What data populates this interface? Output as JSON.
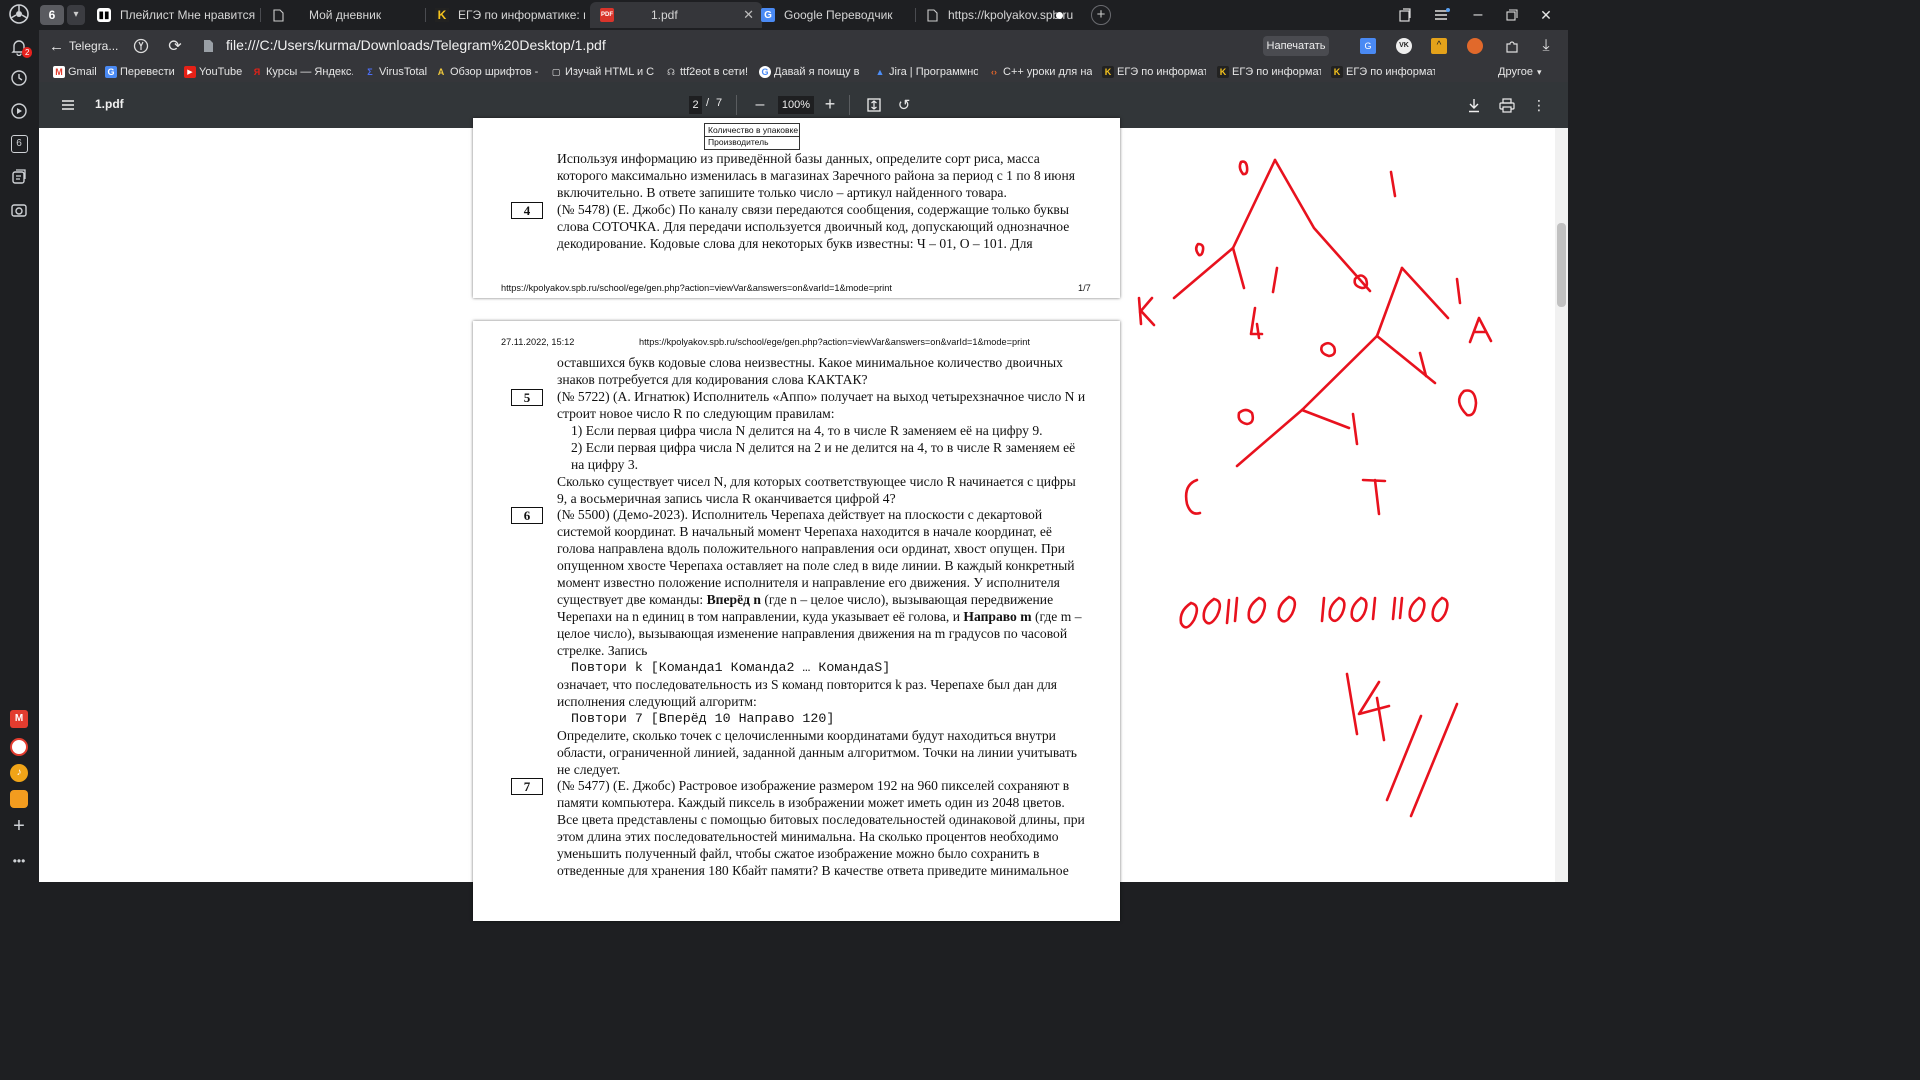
{
  "browser": {
    "tab_count": "6",
    "tabs": [
      {
        "title": "Плейлист Мне нравится -"
      },
      {
        "title": "Мой дневник"
      },
      {
        "title": "ЕГЭ по информатике: гене"
      },
      {
        "title": "1.pdf"
      },
      {
        "title": "Google Переводчик"
      },
      {
        "title": "https://kpolyakov.spb.ru"
      }
    ],
    "address": {
      "site_button": "Telegra...",
      "url": "file:///C:/Users/kurma/Downloads/Telegram%20Desktop/1.pdf",
      "print_label": "Напечатать"
    },
    "bookmarks": [
      "Gmail",
      "Перевести",
      "YouTube",
      "Курсы — Яндекс.",
      "VirusTotal",
      "Обзор шрифтов -",
      "Изучай HTML и С",
      "ttf2eot в сети!",
      "Давай я поищу в г",
      "Jira | Программно",
      "C++ уроки для на",
      "ЕГЭ по информат",
      "ЕГЭ по информат",
      "ЕГЭ по информат"
    ],
    "bookmarks_other": "Другое",
    "sidebar_badge": "2",
    "sidebar_tab_count": "6"
  },
  "pdf_toolbar": {
    "file_name": "1.pdf",
    "current_page": "2",
    "page_sep": "/",
    "total_pages": "7",
    "zoom": "100%"
  },
  "page1": {
    "table_row1": "Количество в упаковке",
    "table_row2": "Производитель",
    "lines": [
      "Используя информацию из приведённой базы данных, определите сорт риса, масса",
      "которого максимально изменилась в магазинах Заречного района за период с 1 по 8 июня",
      "включительно. В ответе запишите только число – артикул найденного товара.",
      "(№ 5478) (Е. Джобс) По каналу связи передаются сообщения, содержащие только буквы",
      "слова СОТОЧКА. Для передачи используется двоичный код, допускающий однозначное",
      "декодирование. Кодовые слова для некоторых букв известны: Ч – 01, О – 101. Для"
    ],
    "task_number": "4",
    "footer_url": "https://kpolyakov.spb.ru/school/ege/gen.php?action=viewVar&answers=on&varId=1&mode=print",
    "footer_page": "1/7"
  },
  "page2": {
    "header_date": "27.11.2022, 15:12",
    "header_url": "https://kpolyakov.spb.ru/school/ege/gen.php?action=viewVar&answers=on&varId=1&mode=print",
    "task_numbers": [
      "5",
      "6",
      "7"
    ],
    "lines": {
      "l01": "оставшихся букв кодовые слова неизвестны. Какое минимальное количество двоичных",
      "l02": "знаков потребуется для кодирования слова КАКТАК?",
      "l03": "(№ 5722) (А. Игнатюк) Исполнитель «Аппо» получает на выход четырехзначное число N и",
      "l04": "строит новое число R по следующим правилам:",
      "l05": "1) Если первая цифра числа N делится на 4, то в числе R заменяем её на цифру 9.",
      "l06": "2) Если первая цифра числа N делится на 2 и не делится на 4, то в числе R заменяем её",
      "l07": "на цифру 3.",
      "l08": "Сколько существует чисел N, для которых соответствующее число R начинается с цифры",
      "l09": "9, а восьмеричная запись числа R оканчивается цифрой 4?",
      "l10": "(№ 5500) (Демо-2023). Исполнитель Черепаха действует на плоскости с декартовой",
      "l11": "системой координат. В начальный момент Черепаха находится в начале координат, её",
      "l12": "голова направлена вдоль положительного направления оси ординат, хвост опущен. При",
      "l13": "опущенном хвосте Черепаха оставляет на поле след в виде линии. В каждый конкретный",
      "l14": "момент известно положение исполнителя и направление его движения. У исполнителя",
      "l15a": "существует две команды: ",
      "l15b": "Вперёд n",
      "l15c": " (где n – целое число), вызывающая передвижение",
      "l16a": "Черепахи на n единиц в том направлении, куда указывает её голова, и ",
      "l16b": "Направо m",
      "l16c": " (где m –",
      "l17": "целое число), вызывающая изменение направления движения на m градусов по часовой",
      "l18": "стрелке. Запись",
      "l19": "Повтори k [Команда1 Команда2 … КомандаS]",
      "l20": "означает, что последовательность из S команд повторится k раз. Черепахе был дан для",
      "l21": "исполнения следующий алгоритм:",
      "l22": "Повтори 7 [Вперёд 10 Направо 120]",
      "l23": "Определите, сколько точек с целочисленными координатами будут находиться внутри",
      "l24": "области, ограниченной линией, заданной данным алгоритмом. Точки на линии учитывать",
      "l25": "не следует.",
      "l26": "(№ 5477) (Е. Джобс) Растровое изображение размером 192 на 960 пикселей сохраняют в",
      "l27": "памяти компьютера. Каждый пиксель в изображении может иметь один из 2048 цветов.",
      "l28": "Все цвета представлены с помощью битовых последовательностей одинаковой длины, при",
      "l29": "этом длина этих последовательностей минимальна. На сколько процентов необходимо",
      "l30": "уменьшить полученный файл, чтобы сжатое изображение можно было сохранить в",
      "l31": "отведенные для хранения 180 Кбайт памяти? В качестве ответа приведите минимальное"
    }
  },
  "annotations": {
    "ink_color": "#e8121e",
    "tree_labels": [
      "0",
      "1",
      "0",
      "1",
      "0",
      "1",
      "0",
      "1",
      "0",
      "1"
    ],
    "leaf_labels": [
      "К",
      "Ч",
      "А",
      "С",
      "Т",
      "О"
    ],
    "encoding": "0011 00 1001 1100",
    "answer": "14"
  }
}
